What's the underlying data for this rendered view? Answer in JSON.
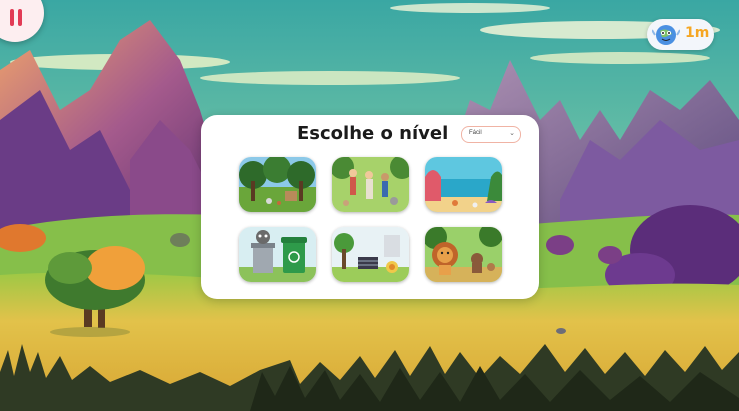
{
  "header": {
    "pause_icon": "pause-icon",
    "timer_icon": "globe-mascot-icon",
    "timer_value": "1m"
  },
  "level_panel": {
    "title": "Escolhe o nível",
    "difficulty_select": {
      "selected": "Fácil",
      "chevron_icon": "chevron-down-icon"
    },
    "levels": [
      {
        "id": "forest"
      },
      {
        "id": "park"
      },
      {
        "id": "beach"
      },
      {
        "id": "recycling"
      },
      {
        "id": "city-garden"
      },
      {
        "id": "savanna"
      }
    ]
  },
  "colors": {
    "accent_red": "#e23b55",
    "timer_orange": "#f5a623"
  }
}
